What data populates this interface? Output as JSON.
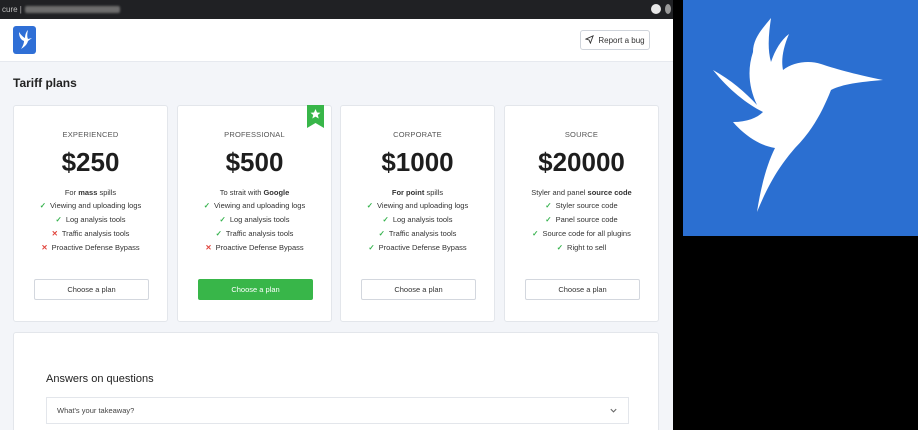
{
  "browser": {
    "url_prefix": "cure |"
  },
  "header": {
    "report_label": "Report a bug"
  },
  "page": {
    "title": "Tariff plans"
  },
  "plans": [
    {
      "name": "EXPERIENCED",
      "price": "$250",
      "lead_pre": "For ",
      "lead_bold": "mass",
      "lead_post": " spills",
      "features": [
        {
          "label": "Viewing and uploading logs",
          "ok": true
        },
        {
          "label": "Log analysis tools",
          "ok": true
        },
        {
          "label": "Traffic analysis tools",
          "ok": false
        },
        {
          "label": "Proactive Defense Bypass",
          "ok": false
        }
      ],
      "button": "Choose a plan"
    },
    {
      "name": "PROFESSIONAL",
      "price": "$500",
      "lead_pre": "To strait with ",
      "lead_bold": "Google",
      "lead_post": "",
      "features": [
        {
          "label": "Viewing and uploading logs",
          "ok": true
        },
        {
          "label": "Log analysis tools",
          "ok": true
        },
        {
          "label": "Traffic analysis tools",
          "ok": true
        },
        {
          "label": "Proactive Defense Bypass",
          "ok": false
        }
      ],
      "button": "Choose a plan"
    },
    {
      "name": "CORPORATE",
      "price": "$1000",
      "lead_pre": "",
      "lead_bold": "For point",
      "lead_post": " spills",
      "features": [
        {
          "label": "Viewing and uploading logs",
          "ok": true
        },
        {
          "label": "Log analysis tools",
          "ok": true
        },
        {
          "label": "Traffic analysis tools",
          "ok": true
        },
        {
          "label": "Proactive Defense Bypass",
          "ok": true
        }
      ],
      "button": "Choose a plan"
    },
    {
      "name": "SOURCE",
      "price": "$20000",
      "lead_pre": "Styler and panel ",
      "lead_bold": "source code",
      "lead_post": "",
      "features": [
        {
          "label": "Styler source code",
          "ok": true
        },
        {
          "label": "Panel source code",
          "ok": true
        },
        {
          "label": "Source code for all plugins",
          "ok": true
        },
        {
          "label": "Right to sell",
          "ok": true
        }
      ],
      "button": "Choose a plan"
    }
  ],
  "faq": {
    "title": "Answers on questions",
    "items": [
      {
        "question": "What's your takeaway?"
      }
    ]
  },
  "colors": {
    "brand": "#2f6fd6",
    "accent_green": "#38b649",
    "cross_red": "#e0423a"
  }
}
